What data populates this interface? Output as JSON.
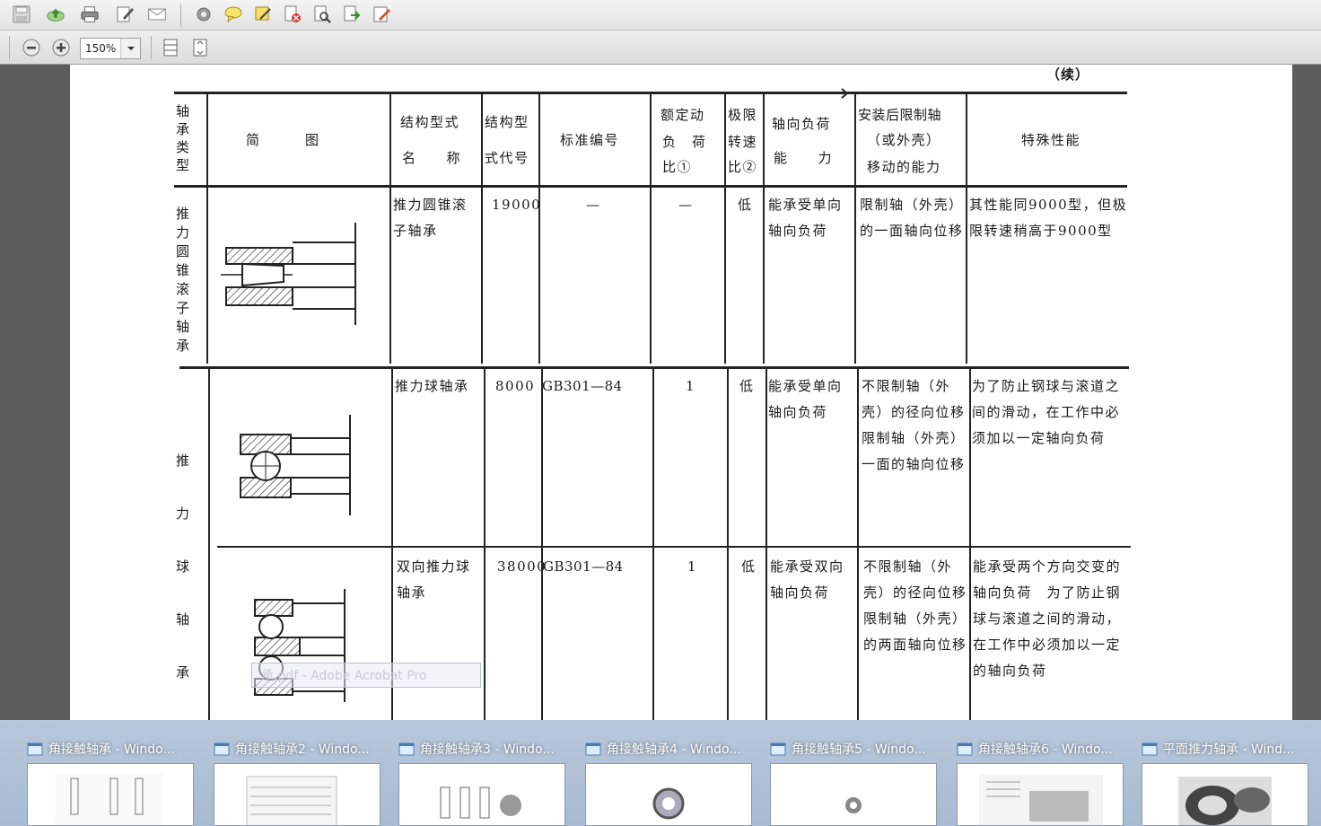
{
  "toolbar": {
    "icons": [
      "save-icon",
      "upload-icon",
      "print-icon",
      "edit-icon",
      "email-icon",
      "settings-icon",
      "comment-icon",
      "highlight-icon",
      "delete-page-icon",
      "find-icon",
      "export-icon",
      "sign-icon"
    ],
    "zoom_out_icon": "zoom-out-icon",
    "zoom_in_icon": "zoom-in-icon",
    "zoom_value": "150%",
    "fit_width_icon": "fit-width-icon",
    "fit_page_icon": "fit-page-icon"
  },
  "document": {
    "continued_label": "（续）",
    "headers": {
      "type": "轴承类型",
      "diagram": "简　　　图",
      "structure_name_1": "结构型式",
      "structure_name_2": "名　　称",
      "code_1": "结构型",
      "code_2": "式代号",
      "standard": "标准编号",
      "rated_load_1": "额定动",
      "rated_load_2": "负　荷",
      "rated_load_3": "比①",
      "speed_1": "极限",
      "speed_2": "转速",
      "speed_3": "比②",
      "axial_1": "轴向负荷",
      "axial_2": "能　　力",
      "install_1": "安装后限制轴",
      "install_2": "（或外壳）",
      "install_3": "移动的能力",
      "special": "特殊性能"
    },
    "groups": [
      {
        "type_label": "推力圆锥滚子轴承"
      },
      {
        "type_label": "推力球轴承"
      }
    ],
    "rows": [
      {
        "name": "推力圆锥滚子轴承",
        "code": "19000",
        "standard": "—",
        "rated": "—",
        "speed": "低",
        "axial": "能承受单向轴向负荷",
        "install": "限制轴（外壳）的一面轴向位移",
        "special": "其性能同9000型，但极限转速稍高于9000型"
      },
      {
        "name": "推力球轴承",
        "code": "8000",
        "standard": "GB301—84",
        "rated": "1",
        "speed": "低",
        "axial": "能承受单向轴向负荷",
        "install": "不限制轴（外壳）的径向位移　限制轴（外壳）一面的轴向位移",
        "special": "为了防止钢球与滚道之间的滑动，在工作中必须加以一定轴向负荷"
      },
      {
        "name": "双向推力球轴承",
        "code": "38000",
        "standard": "GB301—84",
        "rated": "1",
        "speed": "低",
        "axial": "能承受双向轴向负荷",
        "install": "不限制轴（外壳）的径向位移　限制轴（外壳）的两面轴向位移",
        "special": "能承受两个方向交变的轴向负荷　为了防止钢球与滚道之间的滑动，在工作中必须加以一定的轴向负荷"
      }
    ],
    "ghost_tooltip": "承.pdf - Adobe Acrobat Pro"
  },
  "taskbar": {
    "items": [
      {
        "title": "角接触轴承 - Windo...",
        "icon": "folder-window-icon"
      },
      {
        "title": "角接触轴承2 - Windo...",
        "icon": "folder-window-icon"
      },
      {
        "title": "角接触轴承3 - Windo...",
        "icon": "folder-window-icon"
      },
      {
        "title": "角接触轴承4 - Windo...",
        "icon": "folder-window-icon"
      },
      {
        "title": "角接触轴承5 - Windo...",
        "icon": "folder-window-icon"
      },
      {
        "title": "角接触轴承6 - Windo...",
        "icon": "folder-window-icon"
      },
      {
        "title": "平面推力轴承 - Wind...",
        "icon": "folder-window-icon"
      }
    ]
  }
}
